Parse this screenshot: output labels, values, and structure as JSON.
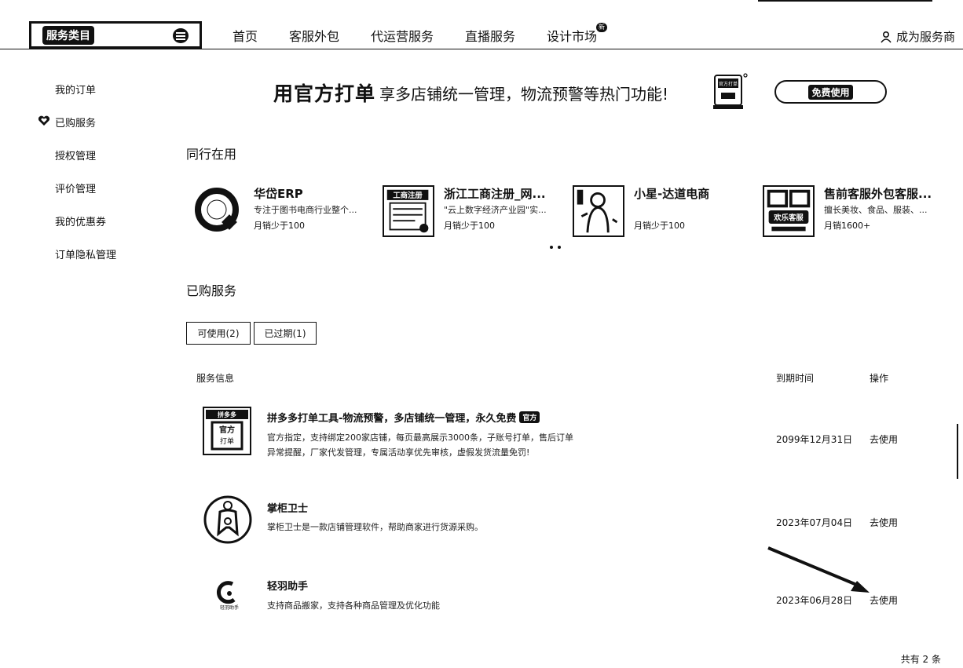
{
  "nav": {
    "category_label": "服务类目",
    "links": [
      "首页",
      "客服外包",
      "代运营服务",
      "直播服务",
      "设计市场"
    ],
    "new_badge": "新",
    "become_provider": "成为服务商"
  },
  "sidebar": {
    "items": [
      {
        "label": "我的订单"
      },
      {
        "label": "已购服务",
        "active": true
      },
      {
        "label": "授权管理"
      },
      {
        "label": "评价管理"
      },
      {
        "label": "我的优惠券"
      },
      {
        "label": "订单隐私管理"
      }
    ]
  },
  "banner": {
    "title": "用官方打单",
    "subtitle": "享多店铺统一管理，物流预警等热门功能!",
    "illus_text": "官方打单",
    "button_label": "免费使用"
  },
  "peers_section": {
    "title": "同行在用",
    "items": [
      {
        "name": "华岱ERP",
        "desc": "专注于图书电商行业整个...",
        "sales": "月销少于100",
        "logo_text": ""
      },
      {
        "name": "浙江工商注册_网...",
        "desc": "\"云上数字经济产业园\"实...",
        "sales": "月销少于100",
        "logo_text": "工商注册"
      },
      {
        "name": "小星-达道电商",
        "desc": "",
        "sales": "月销少于100",
        "logo_text": ""
      },
      {
        "name": "售前客服外包客服...",
        "desc": "擅长美妆、食品、服装、...",
        "sales": "月销1600+",
        "logo_text": "欢乐客服"
      }
    ]
  },
  "purchased": {
    "title": "已购服务",
    "tabs": [
      "可使用(2)",
      "已过期(1)"
    ],
    "columns": {
      "info": "服务信息",
      "expire": "到期时间",
      "action": "操作"
    },
    "rows": [
      {
        "title": "拼多多打单工具-物流预警，多店铺统一管理，永久免费",
        "tag": "官方",
        "desc": "官方指定，支持绑定200家店铺，每页最高展示3000条，子账号打单，售后订单异常提醒，厂家代发管理，专属活动享优先审核，虚假发货流量免罚!",
        "logo_text_top": "拼多多",
        "logo_text_main": "官方",
        "logo_text_sub": "打单",
        "expire": "2099年12月31日",
        "action": "去使用"
      },
      {
        "title": "掌柜卫士",
        "tag": "",
        "desc": "掌柜卫士是一款店铺管理软件，帮助商家进行货源采购。",
        "expire": "2023年07月04日",
        "action": "去使用"
      },
      {
        "title": "轻羽助手",
        "tag": "",
        "desc": "支持商品搬家，支持各种商品管理及优化功能",
        "logo_text": "轻羽助手",
        "expire": "2023年06月28日",
        "action": "去使用"
      }
    ],
    "total": "共有 2 条"
  }
}
